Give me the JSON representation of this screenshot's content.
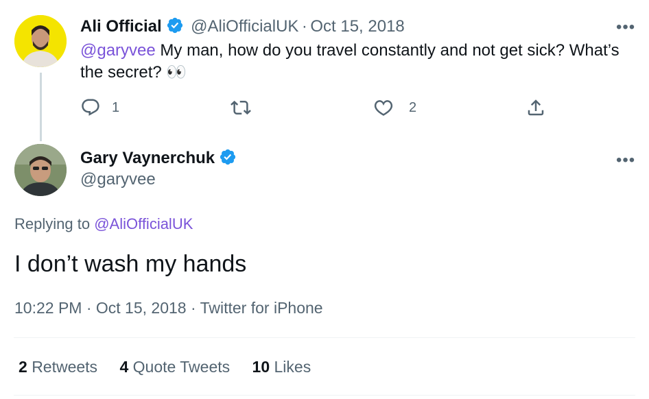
{
  "parent": {
    "name": "Ali Official",
    "handle": "@AliOfficialUK",
    "separator": "·",
    "date": "Oct 15, 2018",
    "mention": "@garyvee",
    "text_line1": " My man, how do you travel constantly and not get sick? What’s",
    "text_line2": "the secret? 👀",
    "reply_count": "1",
    "like_count": "2"
  },
  "main": {
    "name": "Gary Vaynerchuk",
    "handle": "@garyvee",
    "replying_prefix": "Replying to",
    "replying_to": "@AliOfficialUK",
    "text": "I don’t wash my hands",
    "meta": "10:22 PM · Oct 15, 2018 · Twitter for iPhone"
  },
  "stats": {
    "retweets_num": "2",
    "retweets_label": "Retweets",
    "quotes_num": "4",
    "quotes_label": "Quote Tweets",
    "likes_num": "10",
    "likes_label": "Likes"
  },
  "more_label": "•••",
  "colors": {
    "verified": "#1d9bf0",
    "mention": "#7a53d9",
    "muted": "#536471"
  }
}
